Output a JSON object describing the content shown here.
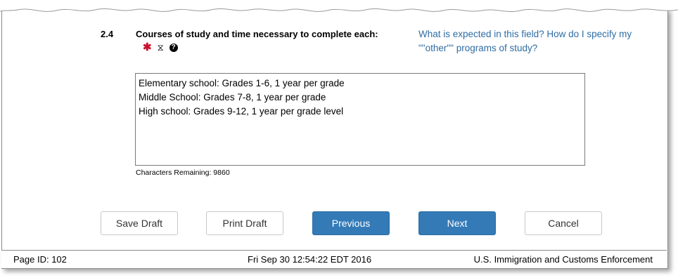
{
  "section": {
    "number": "2.4",
    "title": "Courses of study and time necessary to complete each:",
    "icons": [
      "required-asterisk-icon",
      "hourglass-icon",
      "help-circle-icon"
    ],
    "help_link": "What is expected in this field? How do I specify my \"\"other\"\" programs of study?"
  },
  "textarea": {
    "value": "Elementary school: Grades 1-6, 1 year per grade\nMiddle School: Grades 7-8, 1 year per grade\nHigh school: Grades 9-12, 1 year per grade level"
  },
  "chars_remaining": "Characters Remaining: 9860",
  "buttons": {
    "save_draft": "Save Draft",
    "print_draft": "Print Draft",
    "previous": "Previous",
    "next": "Next",
    "cancel": "Cancel"
  },
  "footer": {
    "page_id": "Page ID: 102",
    "timestamp": "Fri Sep 30 12:54:22 EDT 2016",
    "agency": "U.S. Immigration and Customs Enforcement"
  },
  "colors": {
    "primary": "#337ab7",
    "link": "#2e6da4",
    "required": "#c8102e"
  }
}
